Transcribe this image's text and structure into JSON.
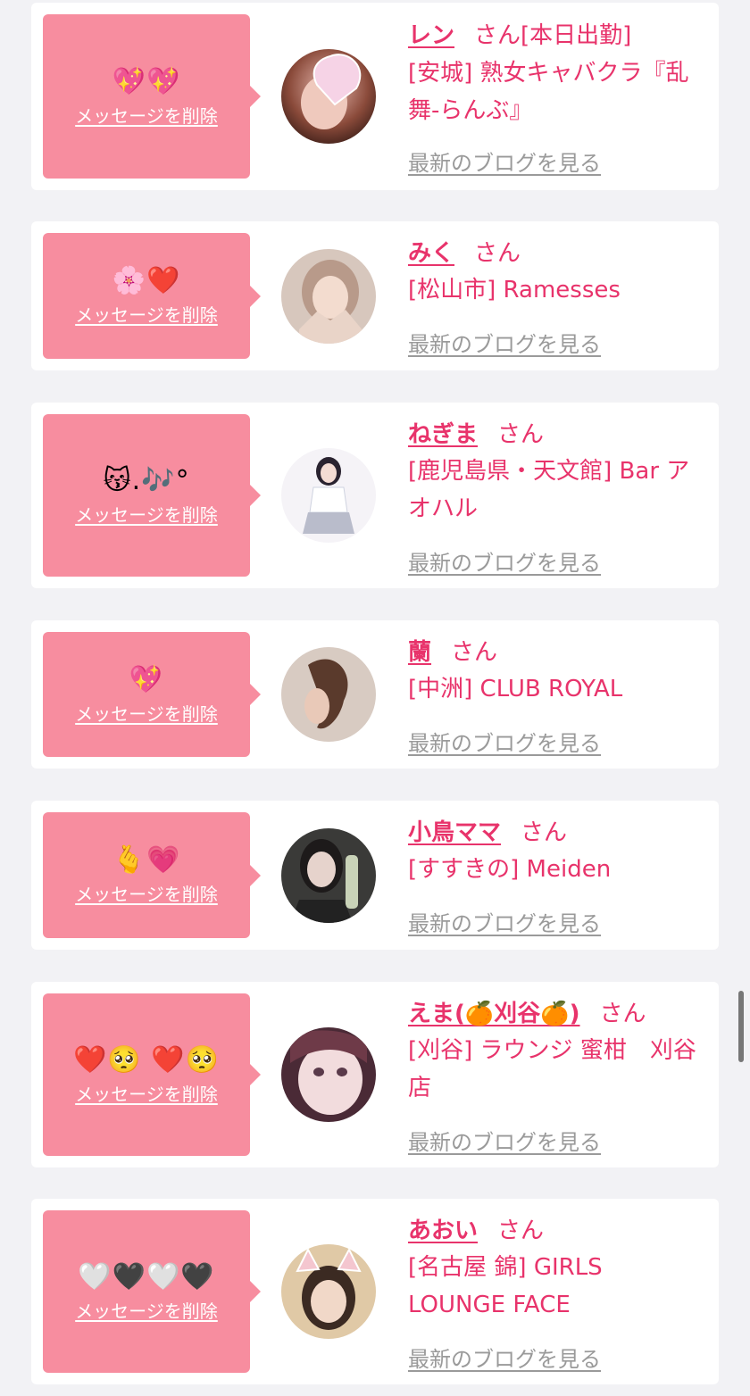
{
  "delete_label": "メッセージを削除",
  "blog_label": "最新のブログを見る",
  "san_label": "さん",
  "colors": {
    "accent": "#e8336b",
    "panel": "#f78d9f",
    "link_gray": "#9a9a9a"
  },
  "items": [
    {
      "emoji": "💖💖",
      "name": "レン",
      "suffix": "[本日出勤]",
      "shop": "[安城] 熟女キャバクラ『乱舞-らんぶ』",
      "avatar_icon": "avatar-woman-heart-sticker"
    },
    {
      "emoji": "🌸❤️",
      "name": "みく",
      "suffix": "",
      "shop": "[松山市] Ramesses",
      "avatar_icon": "avatar-woman-heart-hands"
    },
    {
      "emoji": "😽.🎶°",
      "name": "ねぎま",
      "suffix": "",
      "shop": "[鹿児島県・天文館] Bar アオハル",
      "avatar_icon": "avatar-woman-uniform"
    },
    {
      "emoji": "💖",
      "name": "蘭",
      "suffix": "",
      "shop": "[中洲] CLUB ROYAL",
      "avatar_icon": "avatar-woman-updo"
    },
    {
      "emoji": "🫰💗",
      "name": "小鳥ママ",
      "suffix": "",
      "shop": "[すすきの] Meiden",
      "avatar_icon": "avatar-woman-bar"
    },
    {
      "emoji": "❤️🥺 ❤️🥺",
      "name": "えま(🍊刈谷🍊)",
      "suffix": "",
      "shop": "[刈谷] ラウンジ 蜜柑　刈谷店",
      "avatar_icon": "avatar-woman-closeup"
    },
    {
      "emoji": "🤍🖤🤍🖤",
      "name": "あおい",
      "suffix": "",
      "shop": "[名古屋 錦] GIRLS LOUNGE FACE",
      "avatar_icon": "avatar-woman-cat-ears"
    }
  ]
}
